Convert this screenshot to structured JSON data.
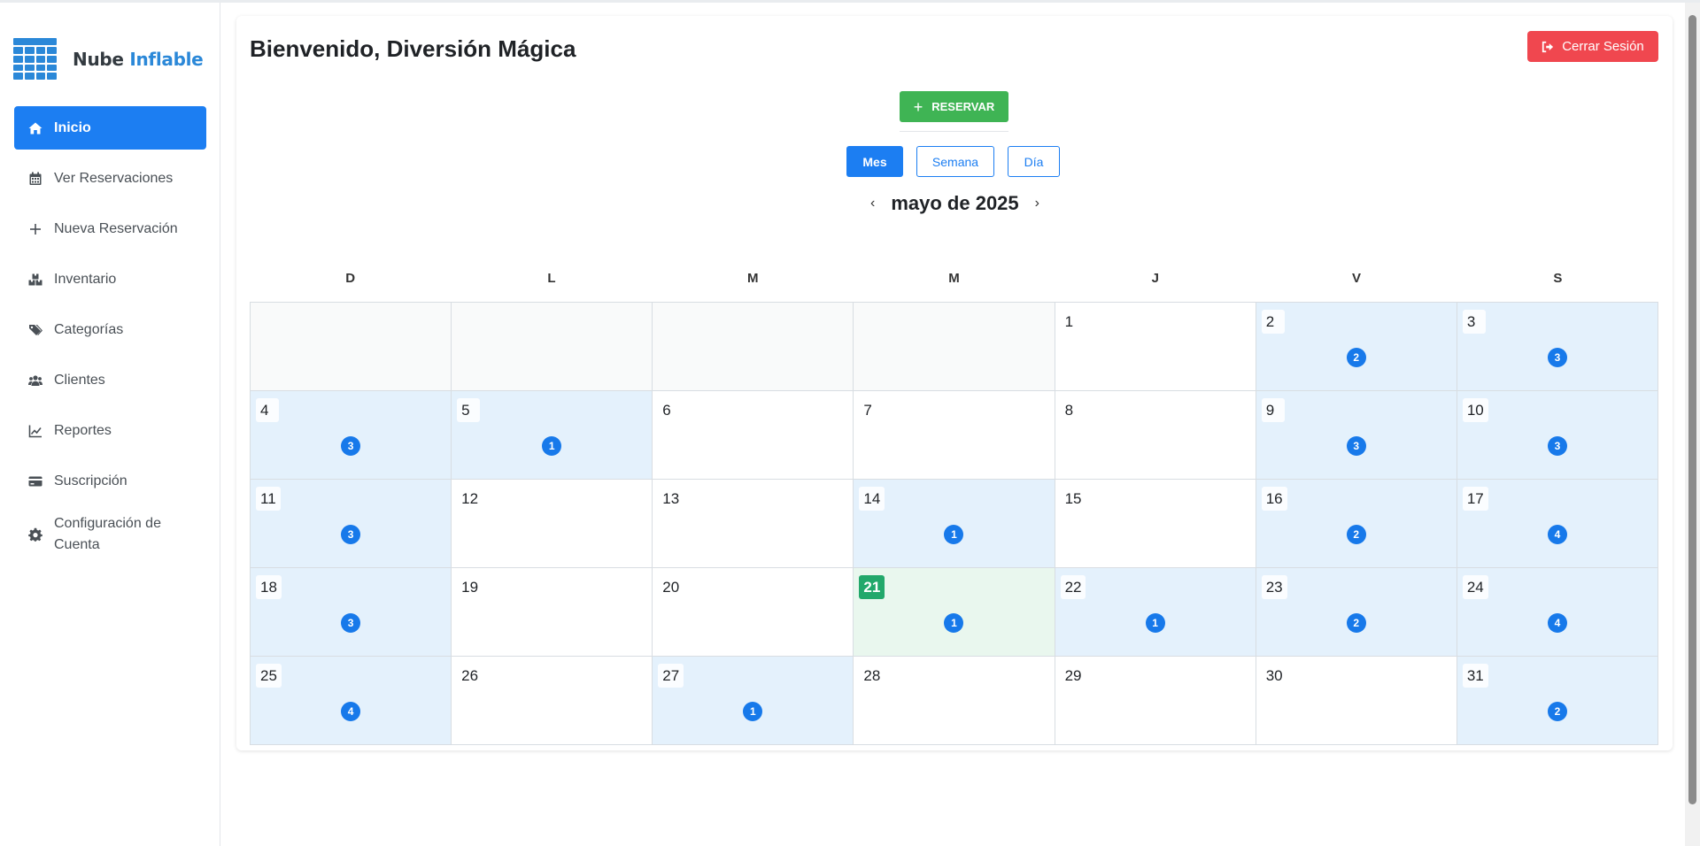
{
  "app": {
    "brand_word1": "Nube",
    "brand_word2": "Inflable",
    "brand_color": "#2b88d8"
  },
  "sidebar": {
    "items": [
      {
        "label": "Inicio",
        "icon": "home-icon",
        "active": true
      },
      {
        "label": "Ver Reservaciones",
        "icon": "calendar-icon",
        "active": false
      },
      {
        "label": "Nueva Reservación",
        "icon": "plus-icon",
        "active": false
      },
      {
        "label": "Inventario",
        "icon": "boxes-icon",
        "active": false
      },
      {
        "label": "Categorías",
        "icon": "tags-icon",
        "active": false
      },
      {
        "label": "Clientes",
        "icon": "users-icon",
        "active": false
      },
      {
        "label": "Reportes",
        "icon": "chart-line-icon",
        "active": false
      },
      {
        "label": "Suscripción",
        "icon": "credit-card-icon",
        "active": false
      },
      {
        "label": "Configuración de Cuenta",
        "icon": "gear-icon",
        "active": false
      }
    ]
  },
  "header": {
    "welcome": "Bienvenido, Diversión Mágica",
    "logout_label": "Cerrar Sesión",
    "logout_color": "#f0474f"
  },
  "toolbar": {
    "reserve_label": "RESERVAR",
    "reserve_color": "#3fb454",
    "views": [
      {
        "label": "Mes",
        "active": true
      },
      {
        "label": "Semana",
        "active": false
      },
      {
        "label": "Día",
        "active": false
      }
    ]
  },
  "calendar": {
    "month_title": "mayo de 2025",
    "prev_glyph": "‹",
    "next_glyph": "›",
    "weekdays": [
      "D",
      "L",
      "M",
      "M",
      "J",
      "V",
      "S"
    ],
    "today": 21,
    "leading_empty": 4,
    "days": [
      {
        "day": 1,
        "count": null
      },
      {
        "day": 2,
        "count": 2
      },
      {
        "day": 3,
        "count": 3
      },
      {
        "day": 4,
        "count": 3
      },
      {
        "day": 5,
        "count": 1
      },
      {
        "day": 6,
        "count": null
      },
      {
        "day": 7,
        "count": null
      },
      {
        "day": 8,
        "count": null
      },
      {
        "day": 9,
        "count": 3
      },
      {
        "day": 10,
        "count": 3
      },
      {
        "day": 11,
        "count": 3
      },
      {
        "day": 12,
        "count": null
      },
      {
        "day": 13,
        "count": null
      },
      {
        "day": 14,
        "count": 1
      },
      {
        "day": 15,
        "count": null
      },
      {
        "day": 16,
        "count": 2
      },
      {
        "day": 17,
        "count": 4
      },
      {
        "day": 18,
        "count": 3
      },
      {
        "day": 19,
        "count": null
      },
      {
        "day": 20,
        "count": null
      },
      {
        "day": 21,
        "count": 1
      },
      {
        "day": 22,
        "count": 1
      },
      {
        "day": 23,
        "count": 2
      },
      {
        "day": 24,
        "count": 4
      },
      {
        "day": 25,
        "count": 4
      },
      {
        "day": 26,
        "count": null
      },
      {
        "day": 27,
        "count": 1
      },
      {
        "day": 28,
        "count": null
      },
      {
        "day": 29,
        "count": null
      },
      {
        "day": 30,
        "count": null
      },
      {
        "day": 31,
        "count": 2
      }
    ]
  }
}
